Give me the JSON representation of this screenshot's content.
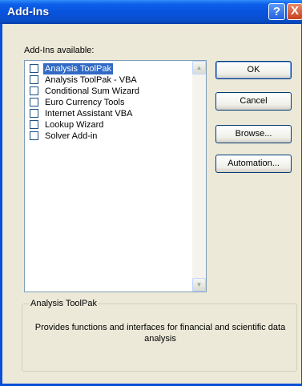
{
  "window": {
    "title": "Add-Ins",
    "help_label": "?",
    "close_label": "X"
  },
  "available_label": "Add-Ins available:",
  "addins": [
    {
      "label": "Analysis ToolPak",
      "checked": false,
      "selected": true
    },
    {
      "label": "Analysis ToolPak - VBA",
      "checked": false,
      "selected": false
    },
    {
      "label": "Conditional Sum Wizard",
      "checked": false,
      "selected": false
    },
    {
      "label": "Euro Currency Tools",
      "checked": false,
      "selected": false
    },
    {
      "label": "Internet Assistant VBA",
      "checked": false,
      "selected": false
    },
    {
      "label": "Lookup Wizard",
      "checked": false,
      "selected": false
    },
    {
      "label": "Solver Add-in",
      "checked": false,
      "selected": false
    }
  ],
  "buttons": {
    "ok": "OK",
    "cancel": "Cancel",
    "browse": "Browse...",
    "automation": "Automation..."
  },
  "details": {
    "title": "Analysis ToolPak",
    "description": "Provides functions and interfaces for financial and scientific data analysis"
  },
  "colors": {
    "title_bar": "#0852dd",
    "selection": "#316ac5",
    "dialog_bg": "#ece9d8"
  }
}
